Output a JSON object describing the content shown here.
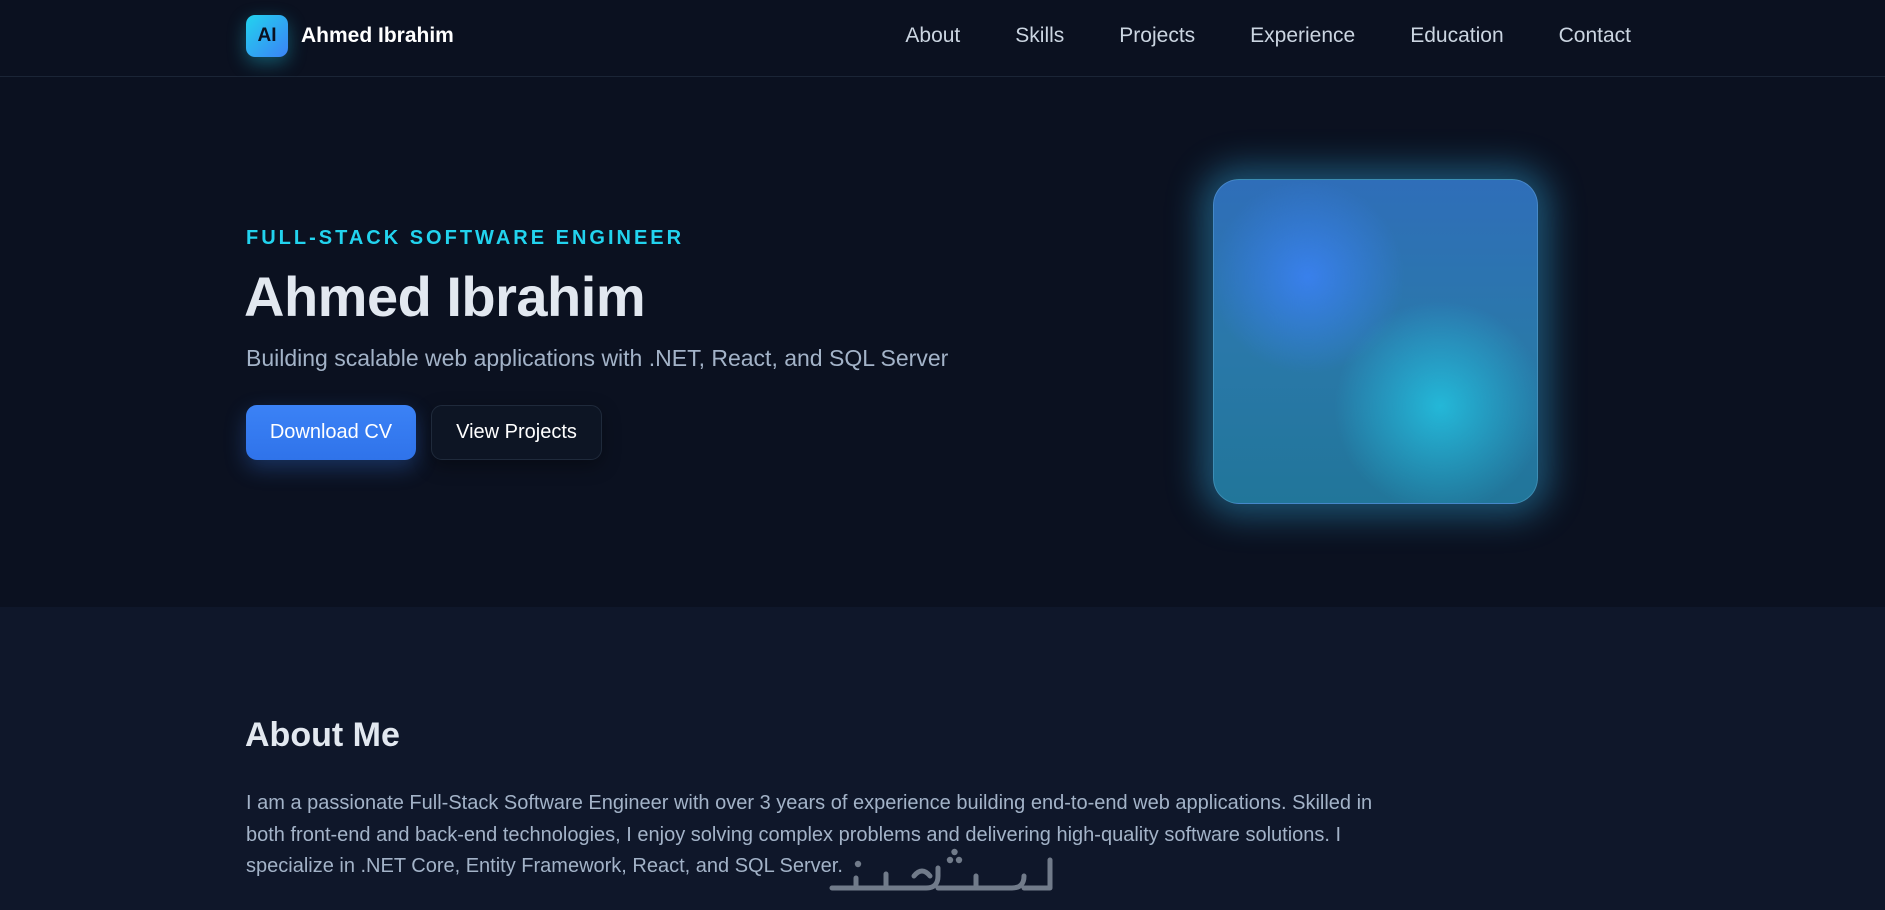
{
  "nav": {
    "logo_text": "AI",
    "brand_name": "Ahmed Ibrahim",
    "links": [
      {
        "label": "About"
      },
      {
        "label": "Skills"
      },
      {
        "label": "Projects"
      },
      {
        "label": "Experience"
      },
      {
        "label": "Education"
      },
      {
        "label": "Contact"
      }
    ]
  },
  "hero": {
    "eyebrow": "FULL-STACK SOFTWARE ENGINEER",
    "title": "Ahmed Ibrahim",
    "subtitle": "Building scalable web applications with .NET, React, and SQL Server",
    "primary_button": "Download CV",
    "secondary_button": "View Projects"
  },
  "about": {
    "title": "About Me",
    "paragraph": "I am a passionate Full-Stack Software Engineer with over 3 years of experience building end-to-end web applications. Skilled in both front-end and back-end technologies, I enjoy solving complex problems and delivering high-quality software solutions. I specialize in .NET Core, Entity Framework, React, and SQL Server."
  },
  "colors": {
    "background": "#0b1120",
    "section_background": "#0f172a",
    "accent_cyan": "#22d3ee",
    "accent_blue": "#3b82f6"
  },
  "icons": {
    "logo": "initials-logo-badge",
    "watermark": "arabic-watermark-logo"
  }
}
